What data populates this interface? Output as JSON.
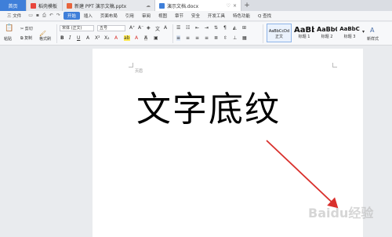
{
  "tabs": {
    "home": "首页",
    "t1": "稻壳模板",
    "t2": "新建 PPT 演示文稿.pptx",
    "t3": "演示文档.docx"
  },
  "menu": {
    "file": "三 文件",
    "items": [
      "开始",
      "插入",
      "页面布局",
      "引用",
      "审阅",
      "视图",
      "章节",
      "安全",
      "开发工具",
      "特色功能"
    ],
    "search": "Q 查找"
  },
  "ribbon": {
    "paste": "粘贴",
    "format_painter": "格式刷",
    "copy": "复制",
    "cut": "剪切",
    "font_name": "宋体 (正文)",
    "font_size": "五号",
    "styles": [
      {
        "sample": "AaBbCcDd",
        "label": "正文"
      },
      {
        "sample": "AaBb",
        "label": "标题 1"
      },
      {
        "sample": "AaBbC",
        "label": "标题 2"
      },
      {
        "sample": "AaBbC",
        "label": "标题 3"
      }
    ],
    "new_style": "新样式"
  },
  "document": {
    "header_label": "页眉",
    "main_text": "文字底纹"
  },
  "watermark": "Baidu经验",
  "colors": {
    "accent": "#3f7fd9",
    "arrow": "#d9302c"
  }
}
